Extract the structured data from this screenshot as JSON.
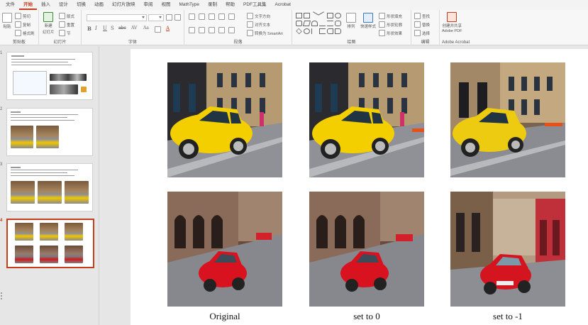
{
  "ribbon": {
    "tabs": [
      {
        "label": "文件",
        "active": false
      },
      {
        "label": "开始",
        "active": true
      },
      {
        "label": "插入",
        "active": false
      },
      {
        "label": "设计",
        "active": false
      },
      {
        "label": "切换",
        "active": false
      },
      {
        "label": "动画",
        "active": false
      },
      {
        "label": "幻灯片放映",
        "active": false
      },
      {
        "label": "审阅",
        "active": false
      },
      {
        "label": "视图",
        "active": false
      },
      {
        "label": "MathType",
        "active": false
      },
      {
        "label": "录制",
        "active": false
      },
      {
        "label": "帮助",
        "active": false
      },
      {
        "label": "PDF工具集",
        "active": false
      },
      {
        "label": "Acrobat",
        "active": false
      }
    ],
    "groups": {
      "clipboard": {
        "label": "剪贴板",
        "paste": "粘贴",
        "cut": "剪切",
        "copy": "复制",
        "format_painter": "格式刷"
      },
      "slides": {
        "label": "幻灯片",
        "new_slide": "新建",
        "new_slide_2": "幻灯片",
        "layout": "版式",
        "reset": "重置",
        "section": "节"
      },
      "font": {
        "label": "字体",
        "font_name": "",
        "font_size": "",
        "bold": "B",
        "italic": "I",
        "underline": "U",
        "shadow": "S",
        "strike": "abc",
        "spacing": "AV",
        "case": "Aa",
        "color": "A"
      },
      "paragraph": {
        "label": "段落",
        "text_direction": "文字方向",
        "align_text": "对齐文本",
        "smartart": "转换为 SmartArt"
      },
      "drawing": {
        "label": "绘图",
        "arrange": "排列",
        "quick_styles": "快速样式",
        "fill": "形状填充",
        "outline": "形状轮廓",
        "effects": "形状效果"
      },
      "editing": {
        "label": "编辑",
        "find": "查找",
        "replace": "替换",
        "select": "选择"
      },
      "acrobat": {
        "label": "Adobe Acrobat",
        "create_share": "创建并共享",
        "adobe_pdf": "Adobe PDF"
      }
    }
  },
  "thumbnails": [
    {
      "number": "1",
      "selected": false
    },
    {
      "number": "2",
      "selected": false
    },
    {
      "number": "3",
      "selected": false
    },
    {
      "number": "4",
      "selected": true
    }
  ],
  "slide": {
    "captions": [
      "Original",
      "set to 0",
      "set to -1"
    ]
  }
}
